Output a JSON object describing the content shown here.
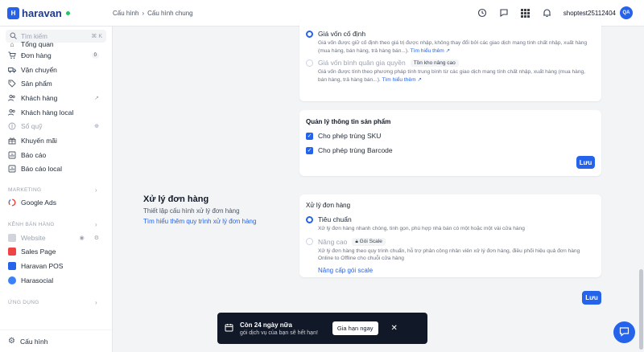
{
  "app": {
    "brand": "haravan",
    "brand_color": "#2563eb"
  },
  "breadcrumb": {
    "parent": "Cấu hình",
    "current": "Cấu hình chung"
  },
  "header": {
    "shop_name": "shoptest25112404",
    "avatar": "QA"
  },
  "search": {
    "placeholder": "Tìm kiếm",
    "shortcut": "⌘ K"
  },
  "sidebar": {
    "items": [
      {
        "label": "Tổng quan",
        "icon": "home-icon"
      },
      {
        "label": "Đơn hàng",
        "icon": "cart-icon",
        "badge": "0"
      },
      {
        "label": "Vận chuyển",
        "icon": "truck-icon"
      },
      {
        "label": "Sản phẩm",
        "icon": "tag-icon"
      },
      {
        "label": "Khách hàng",
        "icon": "users-icon"
      },
      {
        "label": "Khách hàng local",
        "icon": "users-icon"
      },
      {
        "label": "Sổ quỹ",
        "icon": "coin-icon"
      },
      {
        "label": "Khuyến mãi",
        "icon": "gift-icon"
      },
      {
        "label": "Báo cáo",
        "icon": "report-icon"
      },
      {
        "label": "Báo cáo local",
        "icon": "report-icon"
      }
    ],
    "marketing_label": "MARKETING",
    "marketing_items": [
      {
        "label": "Google Ads"
      }
    ],
    "channels_label": "KÊNH BÁN HÀNG",
    "channel_items": [
      {
        "label": "Website",
        "color": "#9ca3af"
      },
      {
        "label": "Sales Page",
        "color": "#ef4444"
      },
      {
        "label": "Haravan POS",
        "color": "#2563eb"
      },
      {
        "label": "Harasocial",
        "color": "#2563eb"
      }
    ],
    "apps_label": "ỨNG DỤNG",
    "settings_label": "Cấu hình"
  },
  "cost": {
    "option1_label": "Giá vốn cố định",
    "option1_desc": "Giá vốn được giữ cố định theo giá trị được nhập, không thay đổi bởi các giao dịch mang tính chất nhập, xuất hàng (mua hàng, bán hàng, trả hàng bán...).",
    "option1_link": "Tìm hiểu thêm",
    "option2_label": "Giá vốn bình quân gia quyền",
    "option2_tag": "Tồn kho nâng cao",
    "option2_desc": "Giá vốn được tính theo phương pháp tính trung bình từ các giao dịch mang tính chất nhập, xuất hàng (mua hàng, bán hàng, trả hàng bán...).",
    "option2_link": "Tìm hiểu thêm"
  },
  "product": {
    "title": "Quản lý thông tin sản phẩm",
    "check1": "Cho phép trùng SKU",
    "check2": "Cho phép trùng Barcode",
    "save": "Lưu"
  },
  "order_section": {
    "title": "Xử lý đơn hàng",
    "subtitle": "Thiết lập cấu hình xử lý đơn hàng",
    "link": "Tìm hiểu thêm quy trình xử lý đơn hàng"
  },
  "order_card": {
    "title": "Xử lý đơn hàng",
    "option1_label": "Tiêu chuẩn",
    "option1_desc": "Xử lý đơn hàng nhanh chóng, tinh gọn, phù hợp nhà bán có một hoặc một vài cửa hàng",
    "option2_label": "Nâng cao",
    "option2_tag": "Gói Scale",
    "option2_desc": "Xử lý đơn hàng theo quy trình chuẩn, hỗ trợ phân công nhân viên xử lý đơn hàng, điều phối hiệu quả đơn hàng Online to Offline cho chuỗi cửa hàng",
    "upgrade_link": "Nâng cấp gói scale"
  },
  "page_save": "Lưu",
  "toast": {
    "title": "Còn 24 ngày nữa",
    "subtitle": "gói dịch vụ của bạn sẽ hết hạn!",
    "button": "Gia hạn ngay"
  }
}
